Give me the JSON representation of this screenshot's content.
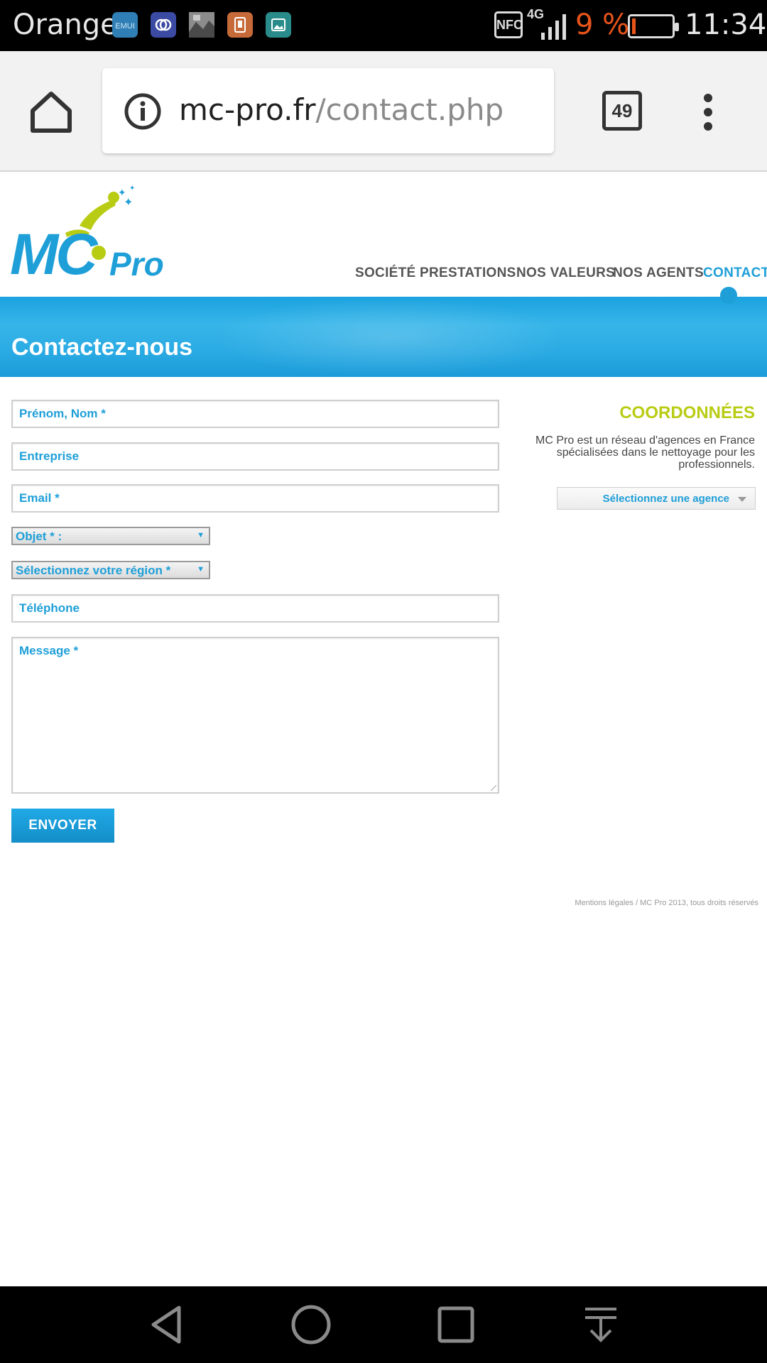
{
  "status_bar": {
    "carrier": "Orange",
    "notifications": [
      "emui-icon",
      "link-icon",
      "photo-thumbnail-icon",
      "clipboard-icon",
      "gallery-icon"
    ],
    "nfc_label": "NFC",
    "network": "4G",
    "battery_percent": "9 %",
    "battery_level": 0.09,
    "time": "11:34"
  },
  "browser": {
    "url_domain": "mc-pro.fr",
    "url_path": "/contact.php",
    "tab_count": "49"
  },
  "site": {
    "logo_text": "MC Pro",
    "nav": [
      "SOCIÉTÉ",
      "PRESTATIONS",
      "NOS VALEURS",
      "NOS AGENTS",
      "CONTACT"
    ],
    "active_nav": "CONTACT",
    "page_title": "Contactez-nous"
  },
  "form": {
    "name_placeholder": "Prénom, Nom *",
    "company_placeholder": "Entreprise",
    "email_placeholder": "Email *",
    "subject_select": "Objet * :",
    "region_select": "Sélectionnez votre région *",
    "phone_placeholder": "Téléphone",
    "message_placeholder": "Message *",
    "submit_label": "ENVOYER"
  },
  "contact_info": {
    "title": "COORDONNÉES",
    "description": "MC Pro est un réseau d'agences en France spécialisées dans le nettoyage pour les professionnels.",
    "agency_select": "Sélectionnez une agence"
  },
  "footer": {
    "text": "Mentions légales / MC Pro 2013, tous droits réservés"
  },
  "colors": {
    "accent_blue": "#1e9fd8",
    "accent_green": "#b9cc14",
    "battery_warning": "#e8541a"
  }
}
